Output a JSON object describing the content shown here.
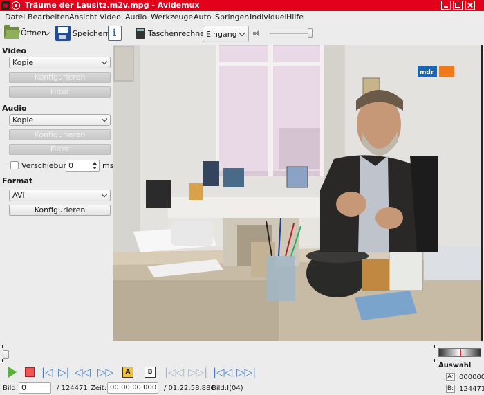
{
  "window": {
    "title": "Träume der Lausitz.m2v.mpg - Avidemux",
    "accent_color": "#e2001a"
  },
  "menu": [
    "Datei",
    "Bearbeiten",
    "Ansicht",
    "Video",
    "Audio",
    "Werkzeuge",
    "Auto",
    "Springen",
    "Individuell",
    "Hilfe"
  ],
  "toolbar": {
    "open_label": "Öffnen",
    "save_label": "Speichern",
    "calculator_label": "Taschenrechner",
    "display_select": "Eingang",
    "volume_level": 0.9
  },
  "video_panel": {
    "title": "Video",
    "codec": "Kopie",
    "configure_label": "Konfigurieren",
    "filters_label": "Filter"
  },
  "audio_panel": {
    "title": "Audio",
    "codec": "Kopie",
    "configure_label": "Konfigurieren",
    "filters_label": "Filter",
    "shift_label": "Verschiebung",
    "shift_value": "0",
    "shift_unit": "ms",
    "shift_enabled": false
  },
  "format_panel": {
    "title": "Format",
    "container": "AVI",
    "configure_label": "Konfigurieren"
  },
  "video_overlay": {
    "channel_logo": "mdr"
  },
  "status": {
    "frame_label": "Bild:",
    "frame_value": "0",
    "frame_total": "/ 124471",
    "time_label": "Zeit:",
    "time_value": "00:00:00.000",
    "time_total": "/ 01:22:58.880",
    "frame_type": "Bild:I(04)",
    "seek_position": 0
  },
  "selection": {
    "title": "Auswahl",
    "a_label": "A:",
    "a_value": "000000",
    "b_label": "B:",
    "b_value": "124471"
  },
  "controls": {
    "marker_a": "A",
    "marker_b": "B"
  }
}
